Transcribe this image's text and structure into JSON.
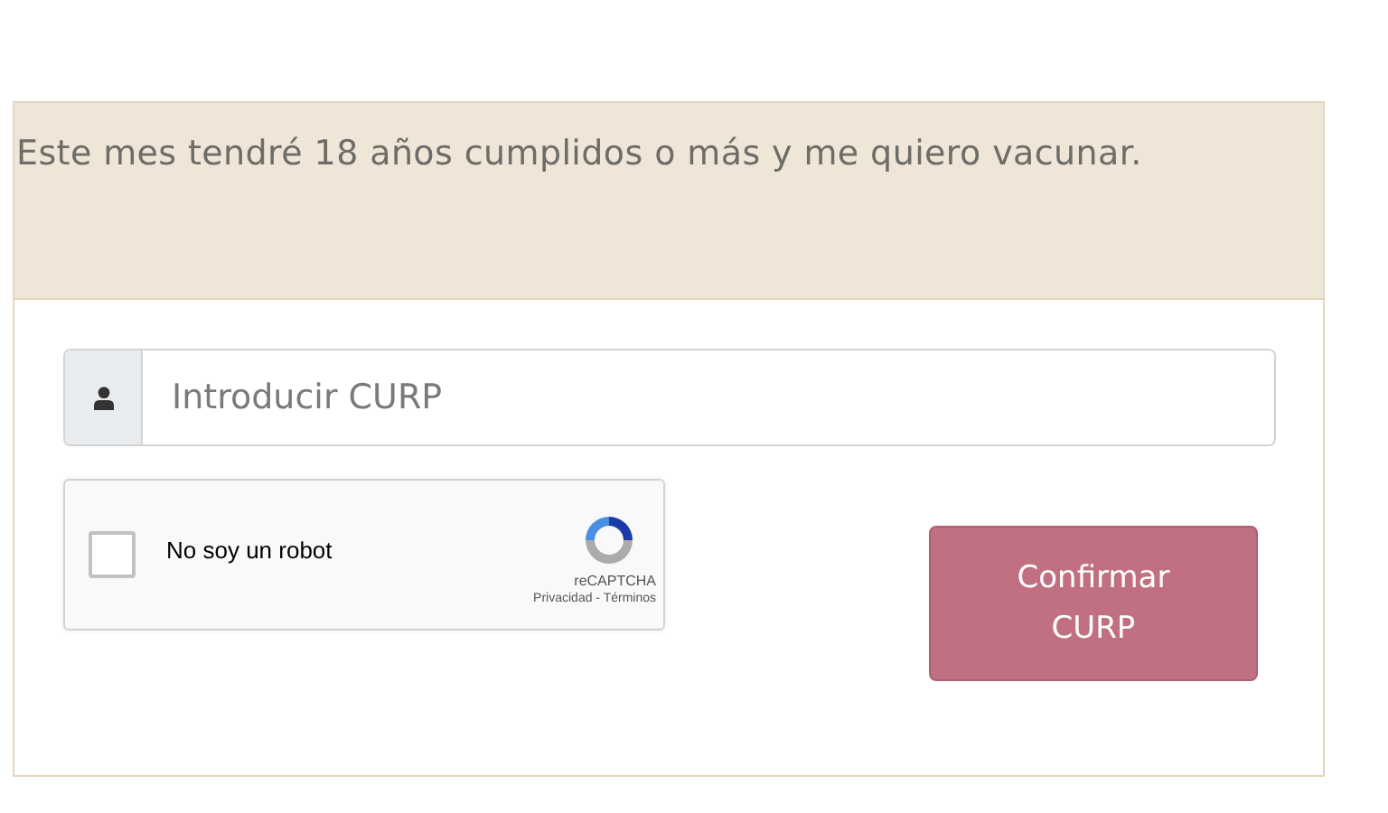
{
  "card": {
    "header": "Este mes tendré 18 años cumplidos o más y me quiero vacunar.",
    "curp_field": {
      "placeholder": "Introducir CURP"
    },
    "captcha": {
      "label": "No soy un robot",
      "checked": false,
      "brand": "reCAPTCHA",
      "links": "Privacidad - Términos"
    },
    "confirm_button": "Confirmar CURP"
  }
}
